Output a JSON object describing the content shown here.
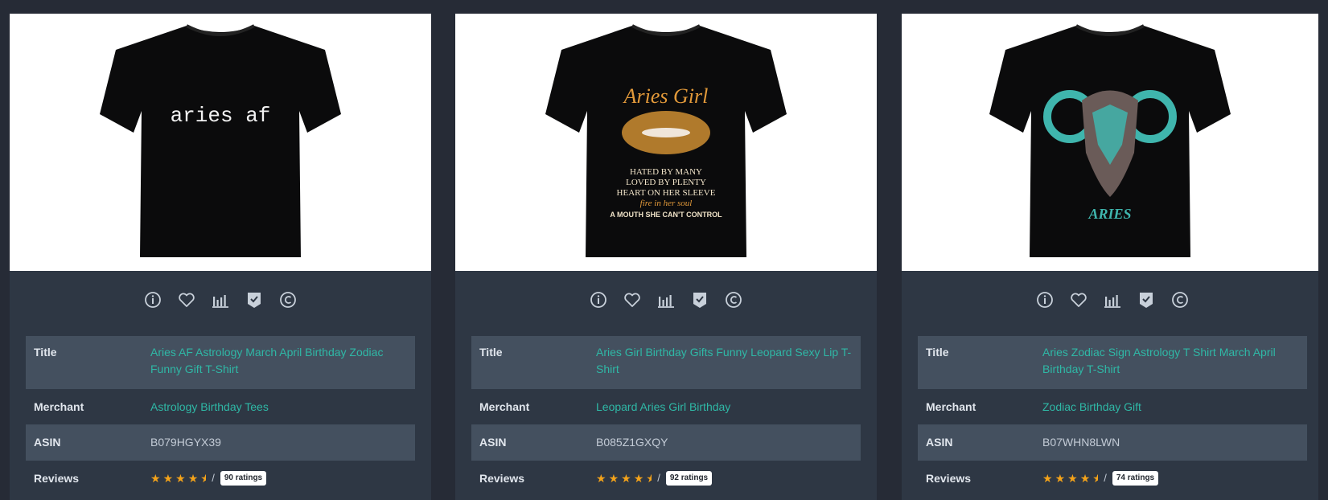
{
  "labels": {
    "title": "Title",
    "merchant": "Merchant",
    "asin": "ASIN",
    "reviews": "Reviews"
  },
  "icons": [
    "info-icon",
    "heart-icon",
    "bar-chart-icon",
    "shield-check-icon",
    "copyright-icon"
  ],
  "colors": {
    "accent": "#2fb8a6",
    "star": "#f4a31a",
    "card": "#2e3744",
    "row": "#44505f"
  },
  "products": [
    {
      "shirt_text": "aries af",
      "title": "Aries AF Astrology March April Birthday Zodiac Funny Gift T-Shirt",
      "merchant": "Astrology Birthday Tees",
      "asin": "B079HGYX39",
      "rating": 4.5,
      "ratings_label": "90 ratings"
    },
    {
      "shirt_text": "Aries Girl",
      "shirt_lines": [
        "HATED BY MANY",
        "LOVED BY PLENTY",
        "HEART ON HER SLEEVE",
        "fire in her soul",
        "A MOUTH SHE CAN'T CONTROL"
      ],
      "title": "Aries Girl Birthday Gifts Funny Leopard Sexy Lip T-Shirt",
      "merchant": "Leopard Aries Girl Birthday",
      "asin": "B085Z1GXQY",
      "rating": 4.5,
      "ratings_label": "92 ratings"
    },
    {
      "shirt_text": "ARIES",
      "title": "Aries Zodiac Sign Astrology T Shirt March April Birthday T-Shirt",
      "merchant": "Zodiac Birthday Gift",
      "asin": "B07WHN8LWN",
      "rating": 4.5,
      "ratings_label": "74 ratings"
    }
  ]
}
